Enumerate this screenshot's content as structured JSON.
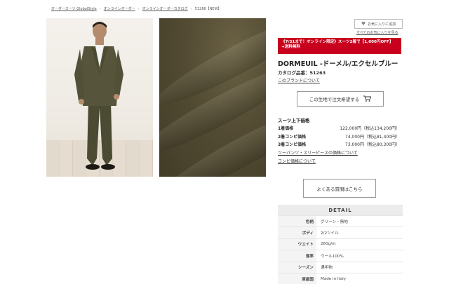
{
  "breadcrumb": [
    "オーダースーツ GlobalStyle",
    "オンラインオーダー",
    "オンラインオーダーカタログ",
    "51266【NEW】"
  ],
  "breadcrumb_sep": "›",
  "favorite": {
    "button_label": "お気に入りに追加",
    "link_label": "すべてのお気に入りを見る"
  },
  "banner": {
    "text": "《7/31まで！オンライン限定》スーツ2着で【1,000円OFF】+送料無料",
    "color": "#c8001d"
  },
  "product": {
    "title": "DORMEUIL -ドーメル/エクセルブルー",
    "code": "カタログ品番：51263",
    "brand_link": "このブランドについて"
  },
  "order_button": "この生地で注文希望する",
  "prices": {
    "heading": "スーツ上下価格",
    "rows": [
      {
        "label": "1着価格",
        "value": "122,000円（税込134,200円）"
      },
      {
        "label": "2着コンビ価格",
        "value": "74,000円（税込81,400円）"
      },
      {
        "label": "3着コンビ価格",
        "value": "73,000円（税込80,300円）"
      }
    ],
    "links": [
      "ツーパンツ・スリーピースの価格について",
      "コンビ価格について"
    ]
  },
  "faq_button": "よくある質問はこちら",
  "detail": {
    "heading": "DETAIL",
    "rows": [
      {
        "key": "色柄",
        "value": "グリーン・無地"
      },
      {
        "key": "ボディ",
        "value": "2/2ツイル"
      },
      {
        "key": "ウエイト",
        "value": "260g/m"
      },
      {
        "key": "混率",
        "value": "ウール100%"
      },
      {
        "key": "シーズン",
        "value": "通年物"
      },
      {
        "key": "原産国",
        "value": "Made in Italy"
      }
    ]
  },
  "icons": {
    "heart": "heart-icon",
    "cart": "cart-icon"
  },
  "colors": {
    "accent_red": "#c8001d",
    "suit_olive": "#4b4a33"
  }
}
